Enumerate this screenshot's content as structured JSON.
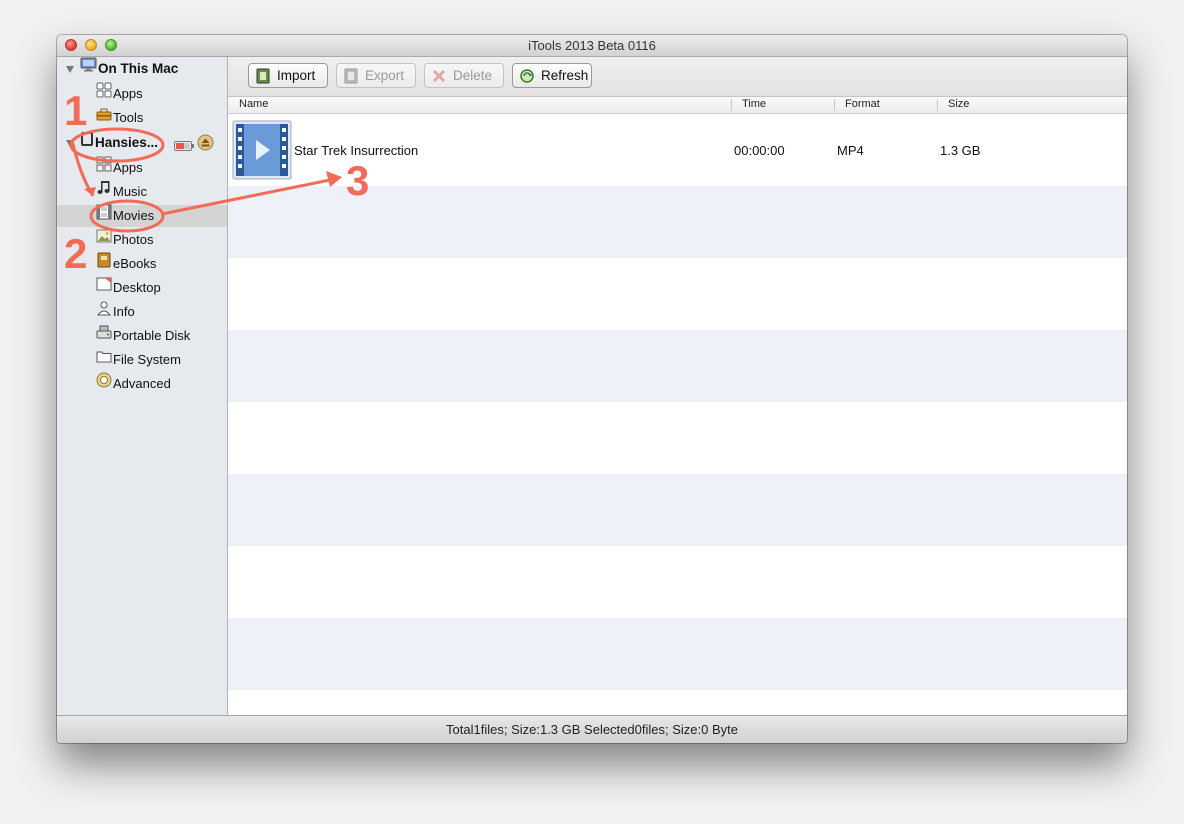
{
  "window": {
    "title": "iTools 2013 Beta 0116"
  },
  "sidebar": {
    "mac_section": {
      "label": "On This Mac",
      "items": [
        {
          "label": "Apps"
        },
        {
          "label": "Tools"
        }
      ]
    },
    "device_section": {
      "label": "Hansies...",
      "items": [
        {
          "label": "Apps"
        },
        {
          "label": "Music"
        },
        {
          "label": "Movies"
        },
        {
          "label": "Photos"
        },
        {
          "label": "eBooks"
        },
        {
          "label": "Desktop"
        },
        {
          "label": "Info"
        },
        {
          "label": "Portable Disk"
        },
        {
          "label": "File System"
        },
        {
          "label": "Advanced"
        }
      ],
      "selected": "Movies"
    }
  },
  "toolbar": {
    "import_label": "Import",
    "export_label": "Export",
    "delete_label": "Delete",
    "refresh_label": "Refresh"
  },
  "columns": {
    "name": "Name",
    "time": "Time",
    "format": "Format",
    "size": "Size"
  },
  "files": [
    {
      "name": "Star Trek Insurrection",
      "time": "00:00:00",
      "format": "MP4",
      "size": "1.3 GB",
      "icon": "movie-file-icon"
    }
  ],
  "status": {
    "text": "Total1files;  Size:1.3 GB   Selected0files;  Size:0 Byte"
  },
  "annotations": {
    "step1": "1",
    "step2": "2",
    "step3": "3",
    "color": "#f26b57"
  },
  "colors": {
    "annotation": "#f26b57",
    "alt_row": "#eef2f8",
    "selected_row": "#d4d4d4",
    "sidebar_bg": "#e6e9ed"
  }
}
